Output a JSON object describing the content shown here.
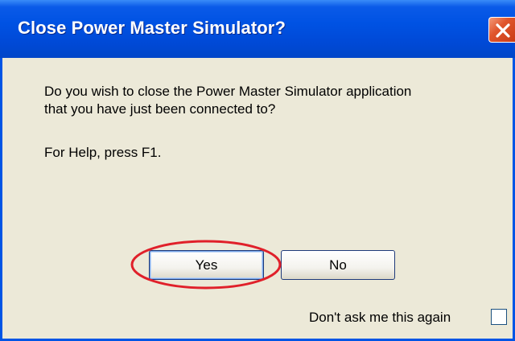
{
  "dialog": {
    "title": "Close Power Master Simulator?",
    "message_line1": "Do you wish to close the Power Master Simulator application",
    "message_line2": "that you have just been connected to?",
    "help_text": "For Help, press F1.",
    "yes_label": "Yes",
    "no_label": "No",
    "dont_ask_label": "Don't ask me this again",
    "dont_ask_checked": false
  },
  "icons": {
    "close": "close-icon"
  },
  "colors": {
    "title_bar": "#0052e3",
    "window_bg": "#ece9d8",
    "close_button": "#e0562d",
    "highlight_ellipse": "#e0202a"
  }
}
